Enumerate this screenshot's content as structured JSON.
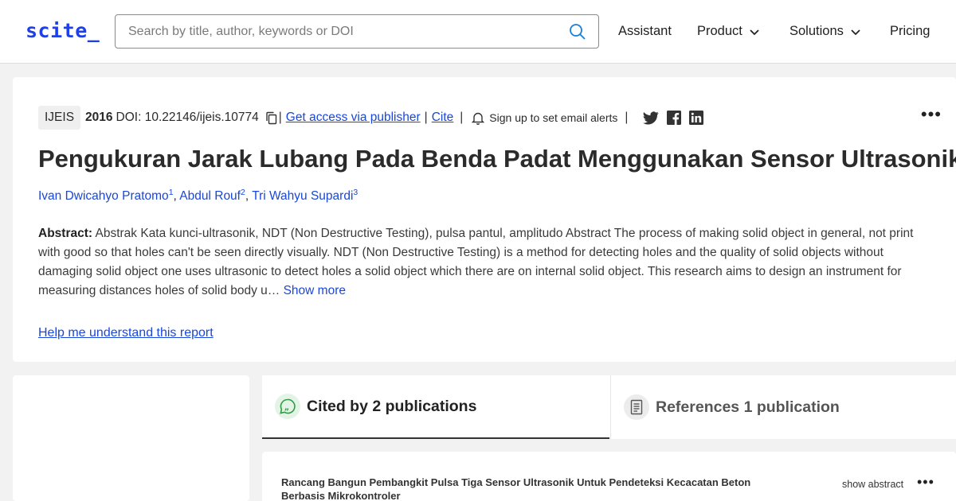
{
  "header": {
    "logo": "scite_",
    "search_placeholder": "Search by title, author, keywords or DOI",
    "nav": {
      "assistant": "Assistant",
      "product": "Product",
      "solutions": "Solutions",
      "pricing": "Pricing"
    }
  },
  "article": {
    "journal": "IJEIS",
    "year": "2016",
    "doi": "DOI: 10.22146/ijeis.10774",
    "get_access": "Get access via publisher",
    "cite": "Cite",
    "alerts": "Sign up to set email alerts",
    "title": "Pengukuran Jarak Lubang Pada Benda Padat Menggunakan Sensor Ultrasonik",
    "authors": [
      {
        "name": "Ivan Dwicahyo Pratomo",
        "sup": "1"
      },
      {
        "name": "Abdul Rouf",
        "sup": "2"
      },
      {
        "name": "Tri Wahyu Supardi",
        "sup": "3"
      }
    ],
    "abstract_label": "Abstract:",
    "abstract_text": "Abstrak Kata kunci-ultrasonik, NDT (Non Destructive Testing), pulsa pantul, amplitudo Abstract The process of making solid object in general, not print with good so that holes can't be seen directly visually. NDT (Non Destructive Testing) is a method for detecting holes and the quality of solid objects without damaging solid object one uses ultrasonic to detect holes a solid object which there are on internal solid object. This research aims to design an instrument for measuring distances holes of solid body u…",
    "show_more": "Show more",
    "help": "Help me understand this report"
  },
  "tabs": {
    "cited_by": "Cited by 2 publications",
    "references": "References 1 publication"
  },
  "publication": {
    "title": "Rancang Bangun Pembangkit Pulsa Tiga Sensor Ultrasonik Untuk Pendeteksi Kecacatan Beton Berbasis Mikrokontroler",
    "show_abstract": "show abstract"
  },
  "colors": {
    "brand": "#1e40e6",
    "link": "#1a47d9",
    "cited_icon": "#2f9e44"
  },
  "icons": [
    "search-icon",
    "chevron-down-icon",
    "copy-icon",
    "bell-icon",
    "twitter-icon",
    "facebook-icon",
    "linkedin-icon",
    "more-icon",
    "quote-bubble-icon",
    "document-icon"
  ]
}
